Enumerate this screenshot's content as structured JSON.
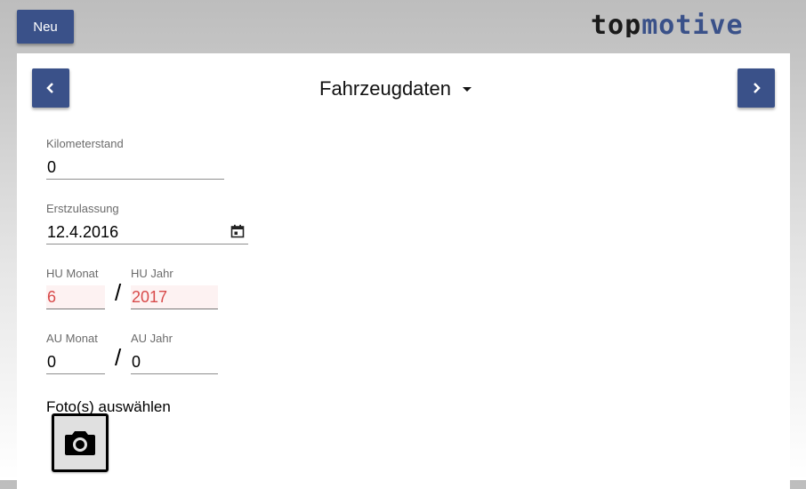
{
  "header": {
    "new_label": "Neu",
    "logo_alt": "topmotive"
  },
  "section": {
    "title": "Fahrzeugdaten"
  },
  "fields": {
    "kilometerstand": {
      "label": "Kilometerstand",
      "value": "0"
    },
    "erstzulassung": {
      "label": "Erstzulassung",
      "value": "12.4.2016"
    },
    "hu_monat": {
      "label": "HU Monat",
      "value": "6"
    },
    "hu_jahr": {
      "label": "HU Jahr",
      "value": "2017"
    },
    "au_monat": {
      "label": "AU Monat",
      "value": "0"
    },
    "au_jahr": {
      "label": "AU Jahr",
      "value": "0"
    },
    "separator": "/"
  },
  "photo": {
    "label": "Foto(s) auswählen",
    "icon": "camera-icon"
  },
  "colors": {
    "accent": "#3a5189",
    "error": "#d84a4a",
    "logo_dark": "#1a1a1a",
    "logo_blue": "#3a5189"
  }
}
